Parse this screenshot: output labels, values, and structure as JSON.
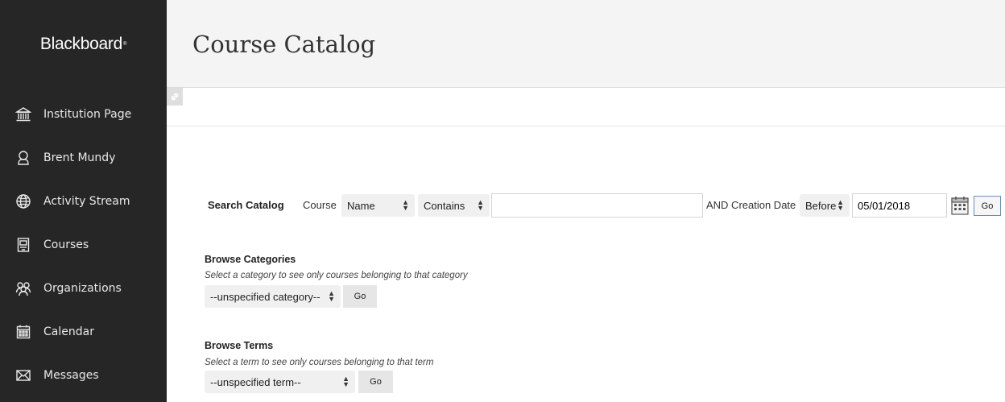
{
  "brand": {
    "name": "Blackboard",
    "mark": "®"
  },
  "nav": [
    {
      "label": "Institution Page",
      "icon": "institution-icon"
    },
    {
      "label": "Brent Mundy",
      "icon": "user-icon"
    },
    {
      "label": "Activity Stream",
      "icon": "globe-icon"
    },
    {
      "label": "Courses",
      "icon": "courses-icon"
    },
    {
      "label": "Organizations",
      "icon": "organizations-icon"
    },
    {
      "label": "Calendar",
      "icon": "calendar-icon"
    },
    {
      "label": "Messages",
      "icon": "envelope-icon"
    }
  ],
  "header": {
    "title": "Course Catalog"
  },
  "search": {
    "label": "Search Catalog",
    "field_label": "Course",
    "field_select": "Name",
    "operator_select": "Contains",
    "query_value": "",
    "date_label": "AND Creation Date",
    "date_operator": "Before",
    "date_value": "05/01/2018",
    "go_label": "Go"
  },
  "categories": {
    "title": "Browse Categories",
    "hint": "Select a category to see only courses belonging to that category",
    "select_value": "--unspecified category--",
    "go_label": "Go"
  },
  "terms": {
    "title": "Browse Terms",
    "hint": "Select a term to see only courses belonging to that term",
    "select_value": "--unspecified term--",
    "go_label": "Go"
  }
}
